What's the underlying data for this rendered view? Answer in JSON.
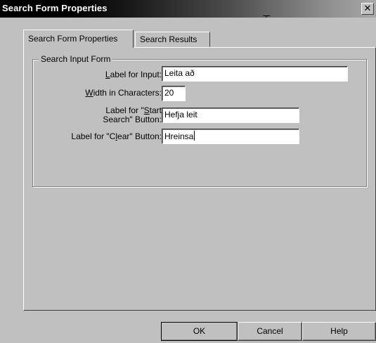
{
  "window": {
    "title": "Search Form Properties",
    "close_glyph": "✕"
  },
  "tabs": [
    {
      "label": "Search Form Properties",
      "active": true
    },
    {
      "label": "Search Results",
      "active": false
    }
  ],
  "group": {
    "label": "Search Input Form",
    "fields": [
      {
        "label": "Label for Input:",
        "value": "Leita að"
      },
      {
        "label": "Width in Characters:",
        "value": "20"
      },
      {
        "label": "Label for \"Start Search\" Button:",
        "value": "Hefja leit"
      },
      {
        "label": "Label for \"Clear\" Button:",
        "value": "Hreinsa"
      }
    ]
  },
  "buttons": {
    "ok": "OK",
    "cancel": "Cancel",
    "help": "Help"
  },
  "colors": {
    "face": "#c0c0c0",
    "title_start": "#000000",
    "title_end": "#a8a8a8"
  }
}
